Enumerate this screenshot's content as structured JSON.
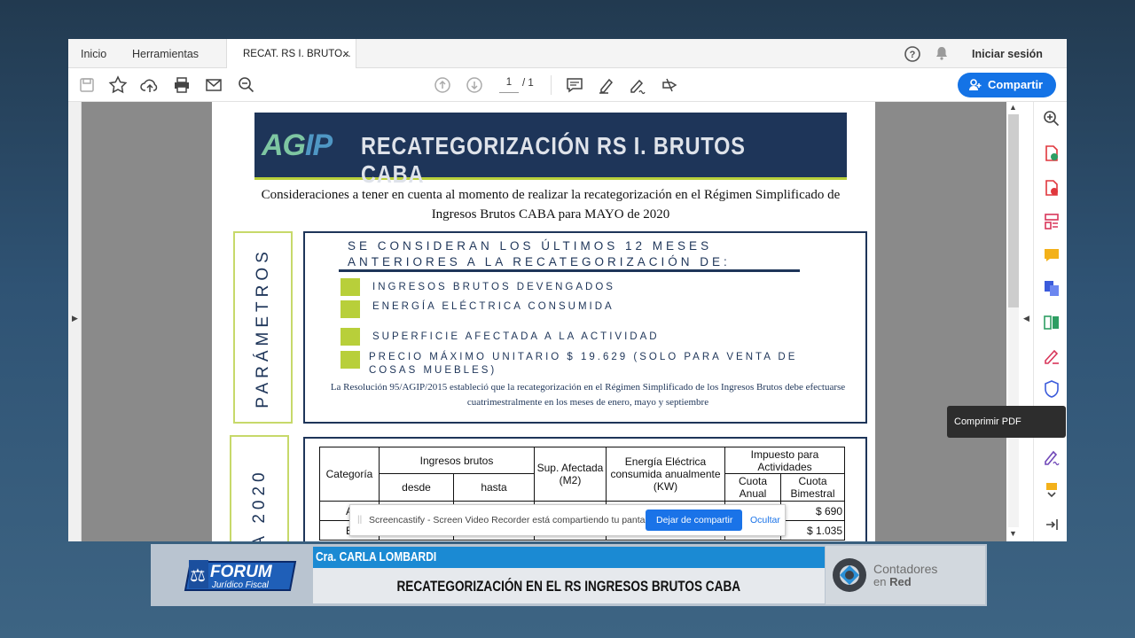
{
  "menubar": {
    "home": "Inicio",
    "tools": "Herramientas",
    "tab_title": "RECAT. RS I. BRUTO...",
    "tab_close": "×",
    "signin": "Iniciar sesión"
  },
  "toolbar": {
    "page_current": "1",
    "page_total": "/ 1",
    "share": "Compartir"
  },
  "pdf": {
    "banner_logo_a": "AG",
    "banner_logo_b": "IP",
    "banner_title": "RECATEGORIZACIÓN RS I. BRUTOS CABA",
    "intro": "Consideraciones a tener en cuenta al momento de realizar la recategorización en el Régimen Simplificado de Ingresos Brutos CABA para MAYO de 2020",
    "side1": "PARÁMETROS",
    "heading": "SE CONSIDERAN LOS ÚLTIMOS 12 MESES ANTERIORES A LA RECATEGORIZACIÓN DE:",
    "items": [
      "INGRESOS BRUTOS DEVENGADOS",
      "ENERGÍA ELÉCTRICA CONSUMIDA",
      "SUPERFICIE AFECTADA A LA ACTIVIDAD",
      "PRECIO MÁXIMO UNITARIO $ 19.629 (SOLO PARA VENTA DE COSAS MUEBLES)"
    ],
    "note": "La Resolución 95/AGIP/2015 estableció que la recategorización en el Régimen Simplificado de los Ingresos Brutos debe efectuarse cuatrimestralmente en los meses de enero, mayo y septiembre",
    "side2": "A 2020",
    "table": {
      "categoria": "Categoría",
      "ingresos": "Ingresos brutos",
      "desde": "desde",
      "hasta": "hasta",
      "sup": "Sup. Afectada (M2)",
      "energia": "Energía Eléctrica consumida anualmente (KW)",
      "impuesto": "Impuesto para Actividades",
      "anual": "Cuota Anual",
      "bimestral": "Cuota Bimestral",
      "rows": [
        {
          "cat": "A",
          "bim": "$ 690"
        },
        {
          "cat": "B",
          "bim": "$ 1.035"
        }
      ]
    }
  },
  "sidebar": {
    "tooltip": "Comprimir PDF"
  },
  "screencastify": {
    "message": "Screencastify - Screen Video Recorder está compartiendo tu pantalla.",
    "stop": "Dejar de compartir",
    "hide": "Ocultar"
  },
  "lower_third": {
    "logo_top": "FORUM",
    "logo_bottom": "Jurídico Fiscal",
    "name": "Cra. CARLA LOMBARDI",
    "subtitle": "RECATEGORIZACIÓN EN EL RS INGRESOS BRUTOS CABA",
    "brand_line1": "Contadores",
    "brand_line2_a": "en ",
    "brand_line2_b": "Red"
  },
  "colors": {
    "accent": "#1473e6",
    "navy": "#1e3559",
    "lime": "#b8cf3a",
    "lower_blue": "#1b8ad3"
  }
}
